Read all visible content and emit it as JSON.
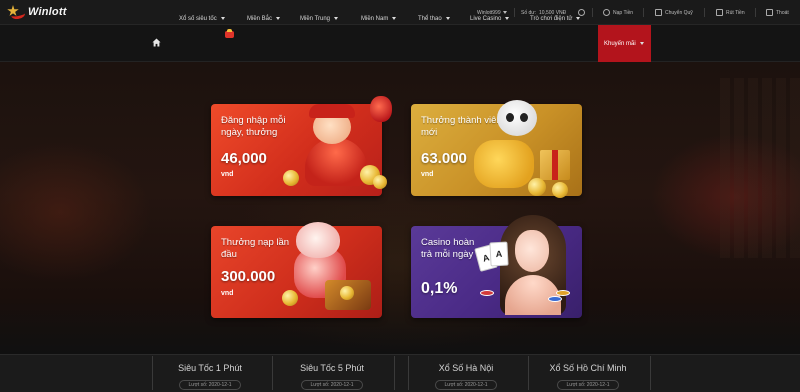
{
  "brand": {
    "name": "Winlott"
  },
  "account": {
    "username": "Winlott999",
    "balance_label": "Số dư:",
    "balance_value": "10,500 VNĐ",
    "links": [
      {
        "label": "Nạp Tiền",
        "icon": "deposit-icon"
      },
      {
        "label": "Chuyển Quỹ",
        "icon": "transfer-icon"
      },
      {
        "label": "Rút Tiền",
        "icon": "withdraw-icon"
      },
      {
        "label": "Thoát",
        "icon": "logout-icon"
      }
    ]
  },
  "nav": {
    "items": [
      {
        "label": "Xổ số siêu tốc",
        "dropdown": true
      },
      {
        "label": "Miền Bắc",
        "dropdown": true
      },
      {
        "label": "Miền Trung",
        "dropdown": true
      },
      {
        "label": "Miền Nam",
        "dropdown": true
      },
      {
        "label": "Thể thao",
        "dropdown": true
      },
      {
        "label": "Live Casino",
        "dropdown": true
      },
      {
        "label": "Trò chơi điện tử",
        "dropdown": true
      },
      {
        "label": "Khuyến mãi",
        "dropdown": true,
        "active": true
      }
    ],
    "active_color": "#b3141c"
  },
  "promos": [
    {
      "text": "Đăng nhập mỗi ngày, thưởng",
      "amount": "46,000",
      "unit": "vnd"
    },
    {
      "text": "Thưởng thành viên mới",
      "amount": "63.000",
      "unit": "vnd"
    },
    {
      "text": "Thưởng nạp lần đầu",
      "amount": "300.000",
      "unit": "vnd"
    },
    {
      "text": "Casino hoàn trả mỗi ngày",
      "amount": "0,1%",
      "unit": ""
    }
  ],
  "lottery": {
    "tabs": [
      {
        "name": "Siêu Tốc 1 Phút",
        "latest": "Lượt số: 2020-12-1"
      },
      {
        "name": "Siêu Tốc 5 Phút",
        "latest": "Lượt số: 2020-12-1"
      },
      {
        "name": "Xổ Số Hà Nội",
        "latest": "Lượt số: 2020-12-1"
      },
      {
        "name": "Xổ Số Hồ Chí Minh",
        "latest": "Lượt số: 2020-12-1"
      }
    ]
  }
}
